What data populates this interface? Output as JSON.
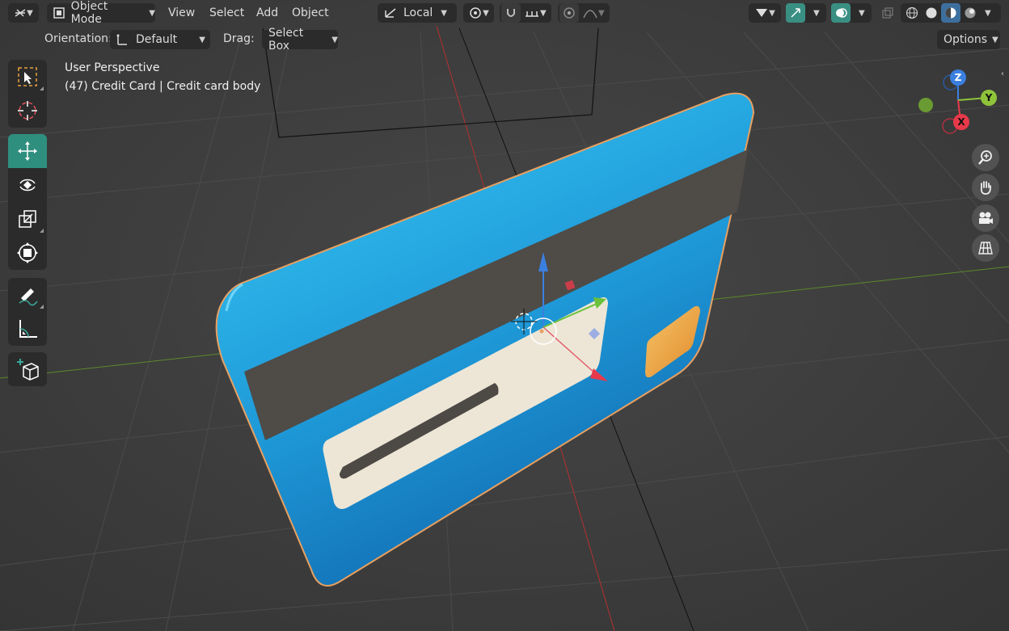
{
  "header": {
    "mode_label": "Object Mode",
    "menus": [
      "View",
      "Select",
      "Add",
      "Object"
    ],
    "transform_orientation": "Local",
    "options_label": "Options"
  },
  "subheader": {
    "orientation_label": "Orientation:",
    "orientation_value": "Default",
    "drag_label": "Drag:",
    "drag_value": "Select Box"
  },
  "overlay": {
    "view_name": "User Perspective",
    "object_info": "(47) Credit Card | Credit card body"
  },
  "gizmo": {
    "x_label": "X",
    "y_label": "Y",
    "z_label": "Z",
    "x_color": "#e8394a",
    "y_color": "#8fc43a",
    "z_color": "#3b7fe0"
  },
  "toolbar": {
    "tools": [
      "select-box",
      "cursor",
      "move",
      "rotate",
      "scale",
      "transform",
      "annotate",
      "measure",
      "add-cube"
    ],
    "active_tool": "move"
  },
  "colors": {
    "accent": "#2f8f7f",
    "card_blue": "#1fa8e0",
    "stripe": "#4f4b47",
    "outline": "#e8a060"
  }
}
